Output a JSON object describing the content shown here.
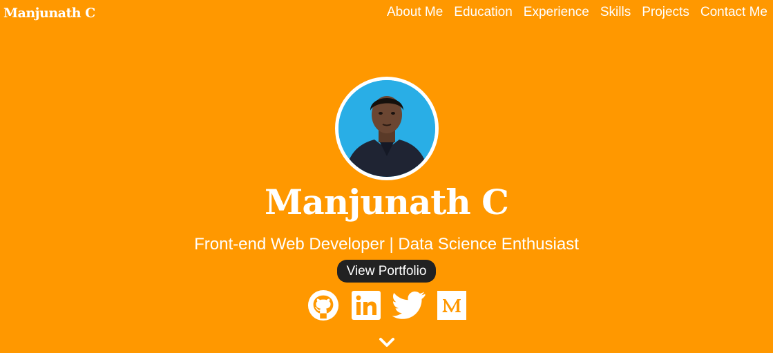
{
  "navbar": {
    "brand": "Manjunath C",
    "links": [
      "About Me",
      "Education",
      "Experience",
      "Skills",
      "Projects",
      "Contact Me"
    ]
  },
  "hero": {
    "name": "Manjunath C",
    "tagline": "Front-end Web Developer | Data Science Enthusiast",
    "cta_label": "View Portfolio",
    "socials": [
      "github-icon",
      "linkedin-icon",
      "twitter-icon",
      "medium-icon"
    ],
    "scroll_icon": "chevron-down-icon"
  },
  "colors": {
    "background": "#ff9800",
    "text": "#ffffff",
    "button_bg": "#222222",
    "avatar_bg": "#2aa8e0"
  }
}
